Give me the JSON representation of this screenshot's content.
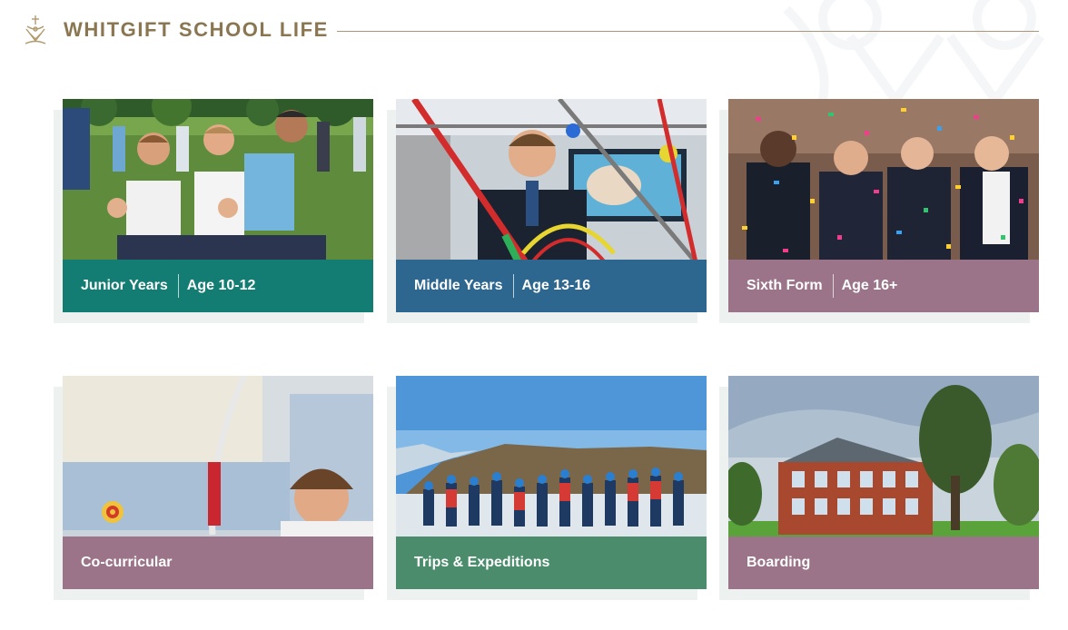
{
  "header": {
    "title": "WHITGIFT SCHOOL LIFE",
    "crest_icon": "school-crest-icon"
  },
  "colors": {
    "brand_gold": "#8a7650",
    "teal": "#137c73",
    "blue": "#2d6790",
    "mauve": "#9b7489",
    "green": "#4b8c6c"
  },
  "cards": [
    {
      "label": "Junior Years",
      "age": "Age 10-12",
      "bar_color": "#137c73"
    },
    {
      "label": "Middle Years",
      "age": "Age 13-16",
      "bar_color": "#2d6790"
    },
    {
      "label": "Sixth Form",
      "age": "Age 16+",
      "bar_color": "#9b7489"
    },
    {
      "label": "Co-curricular",
      "bar_color": "#9b7489"
    },
    {
      "label": "Trips & Expeditions",
      "bar_color": "#4b8c6c"
    },
    {
      "label": "Boarding",
      "bar_color": "#9b7489"
    }
  ]
}
